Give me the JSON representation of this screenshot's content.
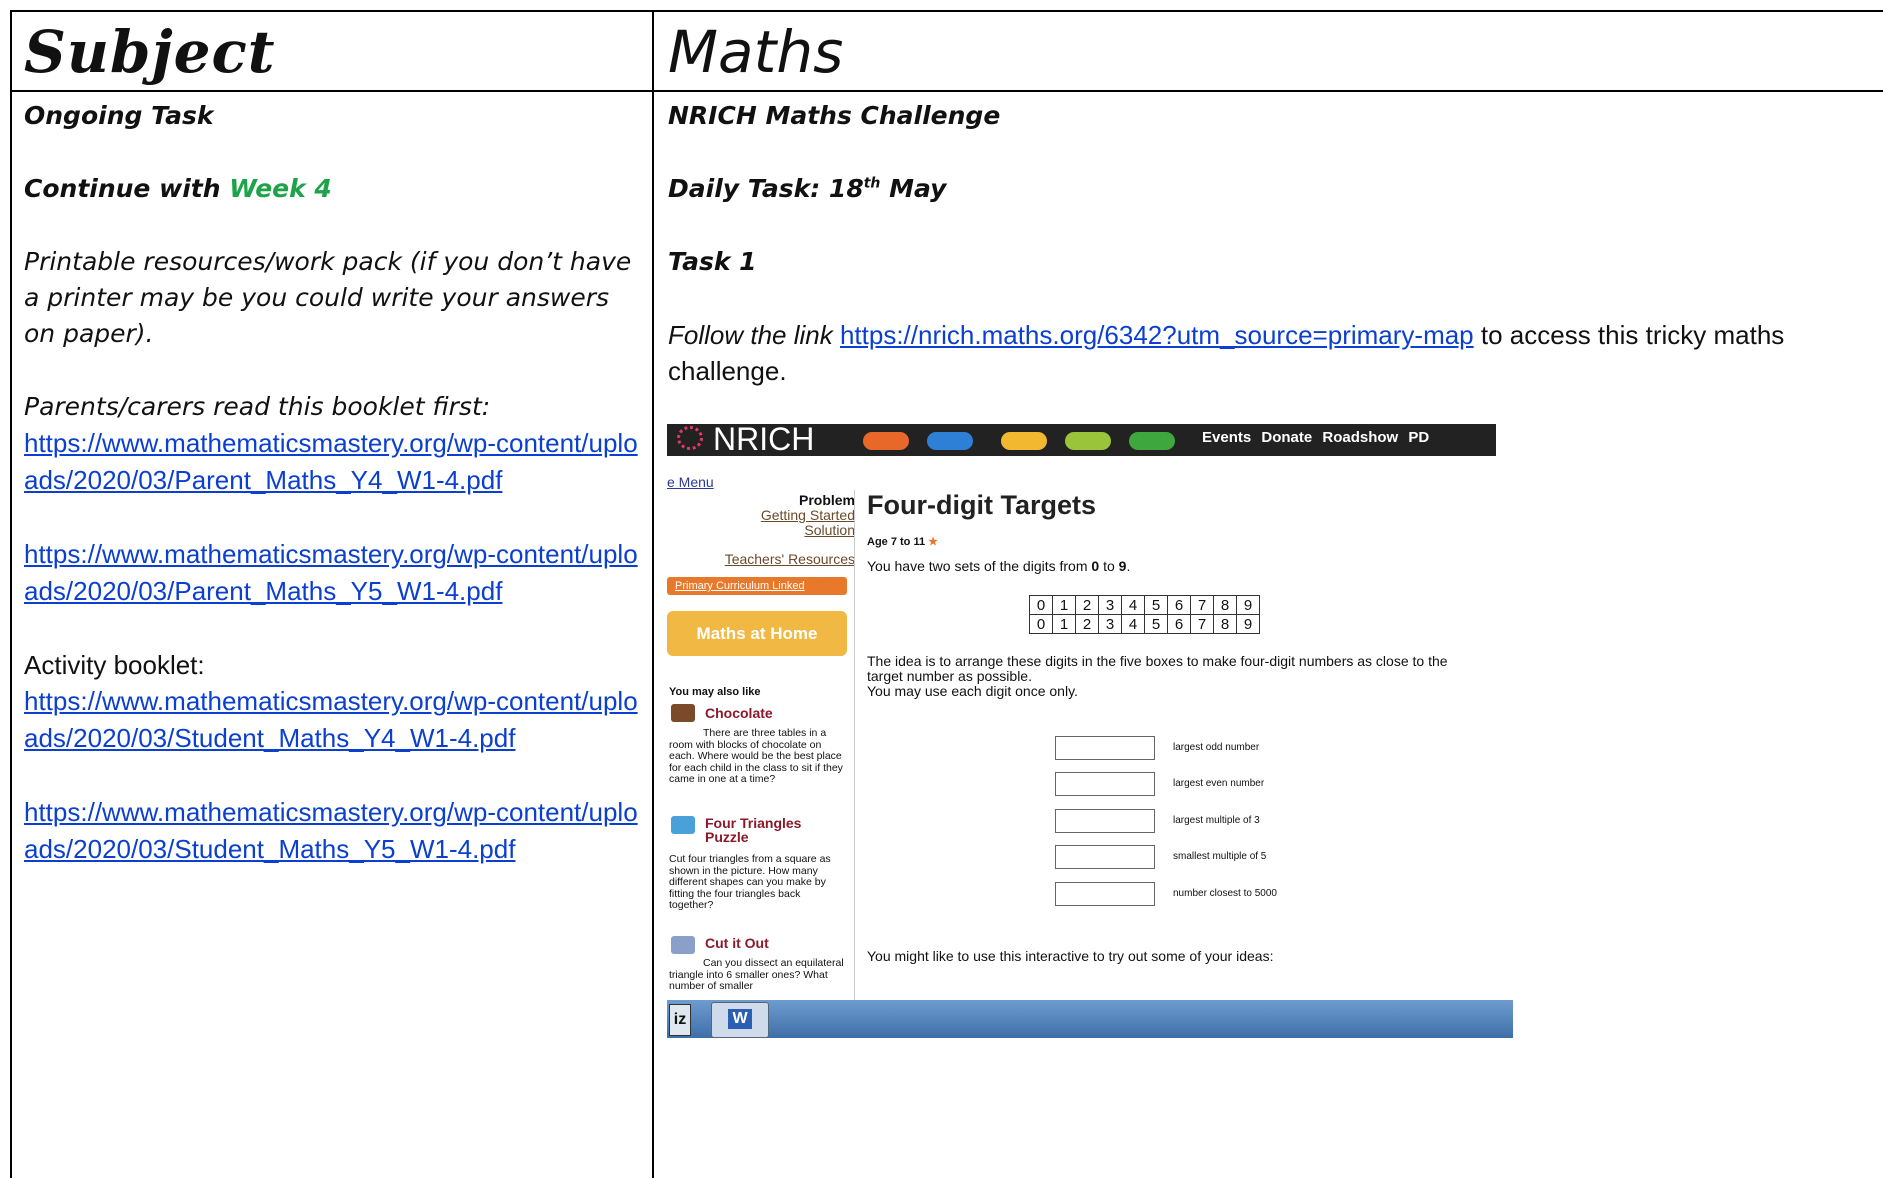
{
  "header": {
    "left_title": "Subject",
    "right_title": "Maths"
  },
  "left": {
    "ongoing_task": "Ongoing Task",
    "continue_prefix": "Continue with ",
    "continue_week": "Week 4",
    "printable": "Printable resources/work pack (if you don’t have a printer may be you could write your answers on paper).",
    "parents_label": "Parents/carers read this booklet first:",
    "link1": "https://www.mathematicsmastery.org/wp-content/uploads/2020/03/Parent_Maths_Y4_W1-4.pdf",
    "link2": "https://www.mathematicsmastery.org/wp-content/uploads/2020/03/Parent_Maths_Y5_W1-4.pdf",
    "activity_label": "Activity booklet:",
    "link3": "https://www.mathematicsmastery.org/wp-content/uploads/2020/03/Student_Maths_Y4_W1-4.pdf",
    "link4": "https://www.mathematicsmastery.org/wp-content/uploads/2020/03/Student_Maths_Y5_W1-4.pdf"
  },
  "right": {
    "challenge_title": "NRICH Maths Challenge",
    "daily_prefix": "Daily Task: 18",
    "daily_sup": "th",
    "daily_suffix": " May",
    "task_label": "Task 1",
    "follow_prefix": "Follow the link ",
    "follow_link": "https://nrich.maths.org/6342?utm_source=primary-map",
    "follow_suffix": " to access this tricky maths challenge."
  },
  "screenshot": {
    "logo": "NRICH",
    "nav": "Events Donate Roadshow PD",
    "menu": "e Menu",
    "side_problem": "Problem",
    "side_getting_started": "Getting Started",
    "side_solution": "Solution",
    "side_teachers": "Teachers' Resources",
    "side_curriculum": "Primary Curriculum Linked",
    "side_home": "Maths at Home",
    "also_like": "You may also like",
    "item1_title": "Chocolate",
    "item1_text": "There are three tables in a room with blocks of chocolate on each. Where would be the best place for each child in the class to sit if they came in one at a time?",
    "item2_title": "Four Triangles Puzzle",
    "item2_text": "Cut four triangles from a square as shown in the picture. How many different shapes can you make by fitting the four triangles back together?",
    "item3_title": "Cut it Out",
    "item3_text": "Can you dissect an equilateral triangle into 6 smaller ones? What number of smaller",
    "title": "Four-digit Targets",
    "age": "Age 7 to 11",
    "intro_prefix": "You have two sets of the digits from ",
    "intro_zero": "0",
    "intro_mid": " to ",
    "intro_nine": "9",
    "intro_suffix": ".",
    "digits_row1": [
      "0",
      "1",
      "2",
      "3",
      "4",
      "5",
      "6",
      "7",
      "8",
      "9"
    ],
    "digits_row2": [
      "0",
      "1",
      "2",
      "3",
      "4",
      "5",
      "6",
      "7",
      "8",
      "9"
    ],
    "idea": "The idea is to arrange these digits in the five boxes to make four-digit numbers as close to the target number as possible.",
    "once": "You may use each digit once only.",
    "targets": [
      "largest odd number",
      "largest even number",
      "largest multiple of 3",
      "smallest multiple of 5",
      "number closest to 5000"
    ],
    "interactive": "You might like to use this interactive to try out some of your ideas:",
    "taskbar_btn1": "iz",
    "taskbar_word": "W"
  }
}
